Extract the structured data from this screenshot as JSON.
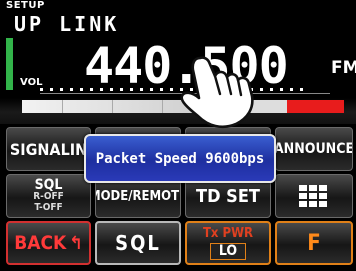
{
  "display": {
    "mode_label": "SETUP",
    "band_label": "UP LINK",
    "volume_label": "VOL",
    "frequency": "440.500",
    "modulation": "FM",
    "accent_green": "#32b44a",
    "meter_red": "#e81c1c"
  },
  "keys": {
    "signaling_label": "SIGNALIN",
    "announce_label": "ANNOUNCE",
    "sql_off_title": "SQL",
    "sql_off_line1": "R-OFF",
    "sql_off_line2": "T-OFF",
    "mode_remote_label": "MODE/REMOTE",
    "td_set_label": "TD SET",
    "grid_icon": "grid-menu-icon",
    "back_label": "BACK",
    "back_icon": "return-arrow-icon",
    "sql_label": "SQL",
    "tx_pwr_label": "Tx PWR",
    "tx_pwr_value": "LO",
    "f_label": "F"
  },
  "popup": {
    "message": "Packet Speed 9600bps"
  },
  "overlay": {
    "icon": "pointing-hand-icon"
  }
}
